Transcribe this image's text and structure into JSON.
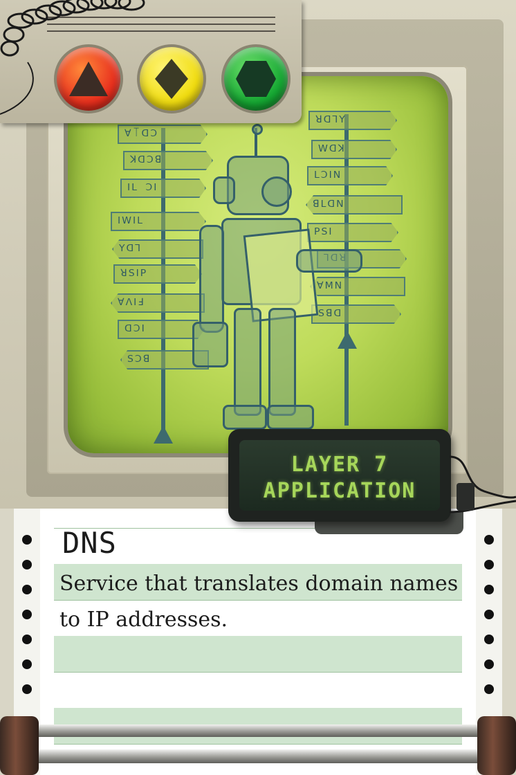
{
  "card": {
    "layer_line1": "LAYER 7",
    "layer_line2": "APPLICATION",
    "term": "DNS",
    "description": "Service that translates domain names to IP addresses."
  },
  "traffic_lights": [
    {
      "color": "red",
      "shape": "triangle"
    },
    {
      "color": "yellow",
      "shape": "diamond"
    },
    {
      "color": "green",
      "shape": "hexagon"
    }
  ],
  "colors": {
    "screen": "#bedb5a",
    "lcd_text": "#a6d65a",
    "paper_band": "#cfe5cf"
  }
}
